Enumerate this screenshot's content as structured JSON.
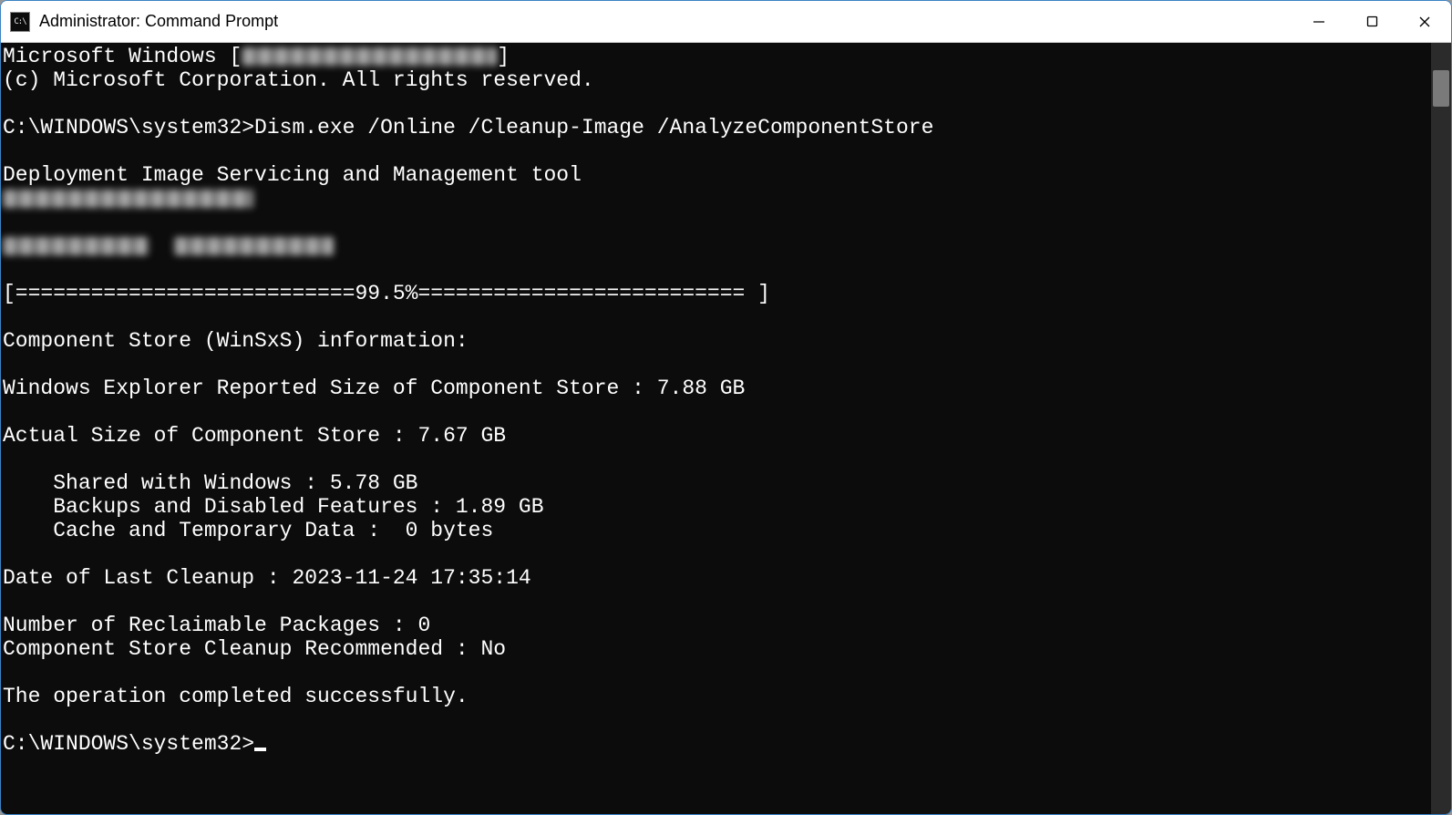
{
  "titlebar": {
    "title": "Administrator: Command Prompt"
  },
  "console": {
    "banner_prefix": "Microsoft Windows [",
    "banner_suffix": "]",
    "copyright": "(c) Microsoft Corporation. All rights reserved.",
    "prompt1": "C:\\WINDOWS\\system32>",
    "command1": "Dism.exe /Online /Cleanup-Image /AnalyzeComponentStore",
    "tool_name": "Deployment Image Servicing and Management tool",
    "progress": "[===========================99.5%========================== ]",
    "info_header": "Component Store (WinSxS) information:",
    "reported_size_line": "Windows Explorer Reported Size of Component Store : 7.88 GB",
    "actual_size_line": "Actual Size of Component Store : 7.67 GB",
    "shared_line": "    Shared with Windows : 5.78 GB",
    "backups_line": "    Backups and Disabled Features : 1.89 GB",
    "cache_line": "    Cache and Temporary Data :  0 bytes",
    "last_cleanup_line": "Date of Last Cleanup : 2023-11-24 17:35:14",
    "reclaimable_line": "Number of Reclaimable Packages : 0",
    "cleanup_rec_line": "Component Store Cleanup Recommended : No",
    "success_line": "The operation completed successfully.",
    "prompt2": "C:\\WINDOWS\\system32>"
  }
}
